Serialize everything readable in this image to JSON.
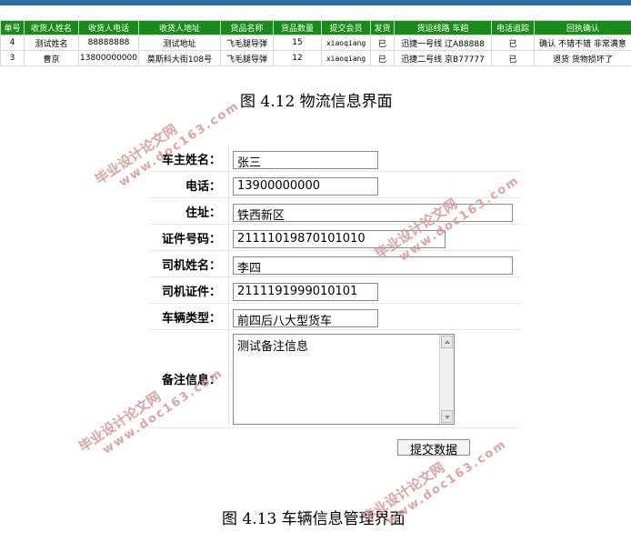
{
  "logistics_table": {
    "headers": [
      "单号",
      "收货人姓名",
      "收货人电话",
      "收货人地址",
      "货品名称",
      "货品数量",
      "提交会员",
      "发货",
      "货运线路 车趟",
      "电话追踪",
      "回执确认"
    ],
    "rows": [
      [
        "4",
        "测试姓名",
        "88888888",
        "测试地址",
        "飞毛腿导弹",
        "15",
        "xiaoqiang",
        "已",
        "迅捷一号线 辽A88888",
        "已",
        "确认 不错不错 非常满意"
      ],
      [
        "3",
        "曹京",
        "13800000000",
        "莫斯科大街108号",
        "飞毛腿导弹",
        "12",
        "xiaoqiang",
        "已",
        "迅捷二号线 京B77777",
        "已",
        "退货 货物损坏了"
      ]
    ]
  },
  "captions": {
    "fig_4_12": "图 4.12  物流信息界面",
    "fig_4_13": "图 4.13  车辆信息管理界面"
  },
  "vehicle_form": {
    "owner_name": {
      "label": "车主姓名：",
      "value": "张三"
    },
    "phone": {
      "label": "电话：",
      "value": "13900000000"
    },
    "address": {
      "label": "住址：",
      "value": "铁西新区"
    },
    "id_number": {
      "label": "证件号码：",
      "value": "21111019870101010"
    },
    "driver_name": {
      "label": "司机姓名：",
      "value": "李四"
    },
    "driver_license": {
      "label": "司机证件：",
      "value": "2111191999010101"
    },
    "vehicle_type": {
      "label": "车辆类型：",
      "value": "前四后八大型货车"
    },
    "remarks": {
      "label": "备注信息：",
      "value": "测试备注信息"
    },
    "submit_label": "提交数据"
  },
  "watermark": {
    "cn": "毕业设计论文网",
    "en": "www.doc163.com"
  }
}
